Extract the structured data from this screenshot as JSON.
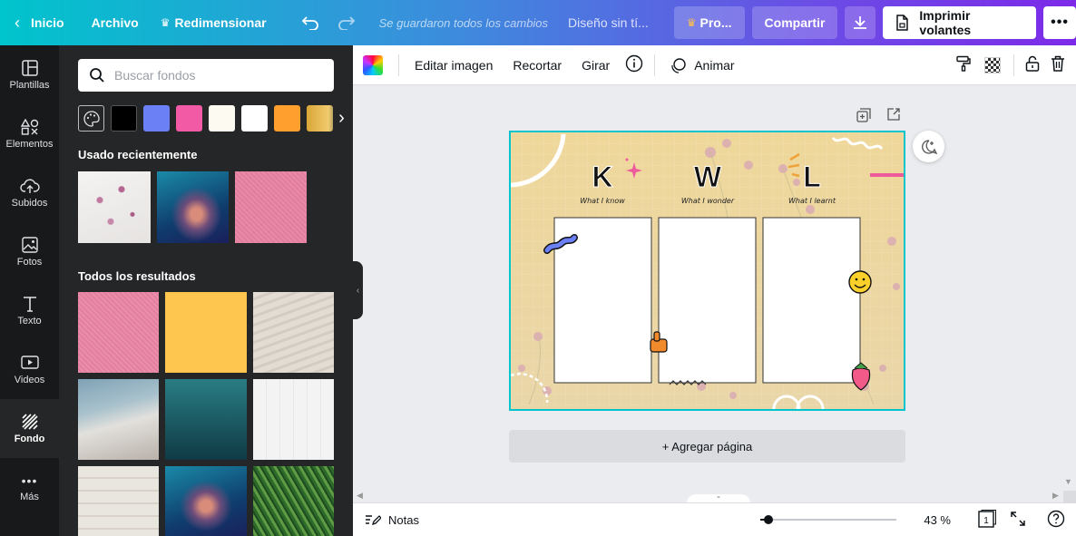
{
  "topbar": {
    "home": "Inicio",
    "file": "Archivo",
    "resize": "Redimensionar",
    "saved_status": "Se guardaron todos los cambios",
    "design_name": "Diseño sin tí...",
    "pro": "Pro...",
    "share": "Compartir",
    "print": "Imprimir volantes"
  },
  "rail": {
    "items": [
      {
        "label": "Plantillas"
      },
      {
        "label": "Elementos"
      },
      {
        "label": "Subidos"
      },
      {
        "label": "Fotos"
      },
      {
        "label": "Texto"
      },
      {
        "label": "Videos"
      },
      {
        "label": "Fondo"
      },
      {
        "label": "Más"
      }
    ]
  },
  "panel": {
    "search_placeholder": "Buscar fondos",
    "swatches": [
      "#000000",
      "#6b80f5",
      "#f25aa6",
      "#fdfaf2",
      "#ffffff",
      "#ff9f2e"
    ],
    "recent_title": "Usado recientemente",
    "all_title": "Todos los resultados"
  },
  "toolbar": {
    "edit_image": "Editar imagen",
    "crop": "Recortar",
    "rotate": "Girar",
    "animate": "Animar"
  },
  "canvas": {
    "letters": [
      "K",
      "W",
      "L"
    ],
    "captions": [
      "What I know",
      "What I wonder",
      "What I learnt"
    ],
    "add_page": "+ Agregar página"
  },
  "bottom": {
    "notes": "Notas",
    "zoom": "43 %",
    "page_number": "1"
  },
  "colors": {
    "accent": "#00c4cc",
    "rail_bg": "#18191b",
    "panel_bg": "#252627"
  }
}
